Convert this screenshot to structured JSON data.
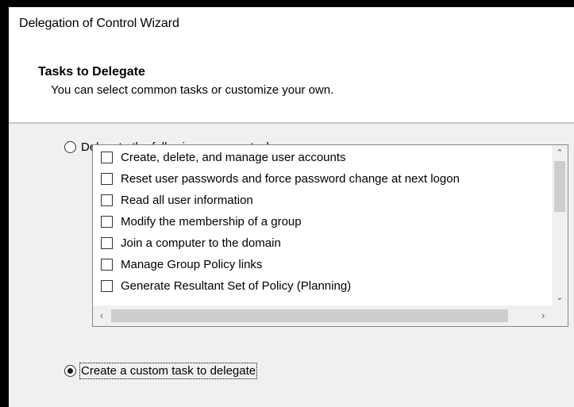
{
  "window": {
    "title": "Delegation of Control Wizard"
  },
  "header": {
    "heading": "Tasks to Delegate",
    "subtitle": "You can select common tasks or customize your own."
  },
  "options": {
    "common": {
      "label": "Delegate the following common tasks:",
      "selected": false
    },
    "custom": {
      "label": "Create a custom task to delegate",
      "selected": true
    }
  },
  "tasks": [
    {
      "label": "Create, delete, and manage user accounts",
      "checked": false
    },
    {
      "label": "Reset user passwords and force password change at next logon",
      "checked": false
    },
    {
      "label": "Read all user information",
      "checked": false
    },
    {
      "label": "Modify the membership of a group",
      "checked": false
    },
    {
      "label": "Join a computer to the domain",
      "checked": false
    },
    {
      "label": "Manage Group Policy links",
      "checked": false
    },
    {
      "label": "Generate Resultant Set of Policy (Planning)",
      "checked": false
    }
  ],
  "icons": {
    "scroll_up": "chevron-up-icon",
    "scroll_down": "chevron-down-icon",
    "scroll_left": "chevron-left-icon",
    "scroll_right": "chevron-right-icon"
  },
  "colors": {
    "background": "#f0f0f0",
    "header": "#ffffff",
    "border": "#828790",
    "scrollbar_thumb": "#cdcdcd"
  }
}
